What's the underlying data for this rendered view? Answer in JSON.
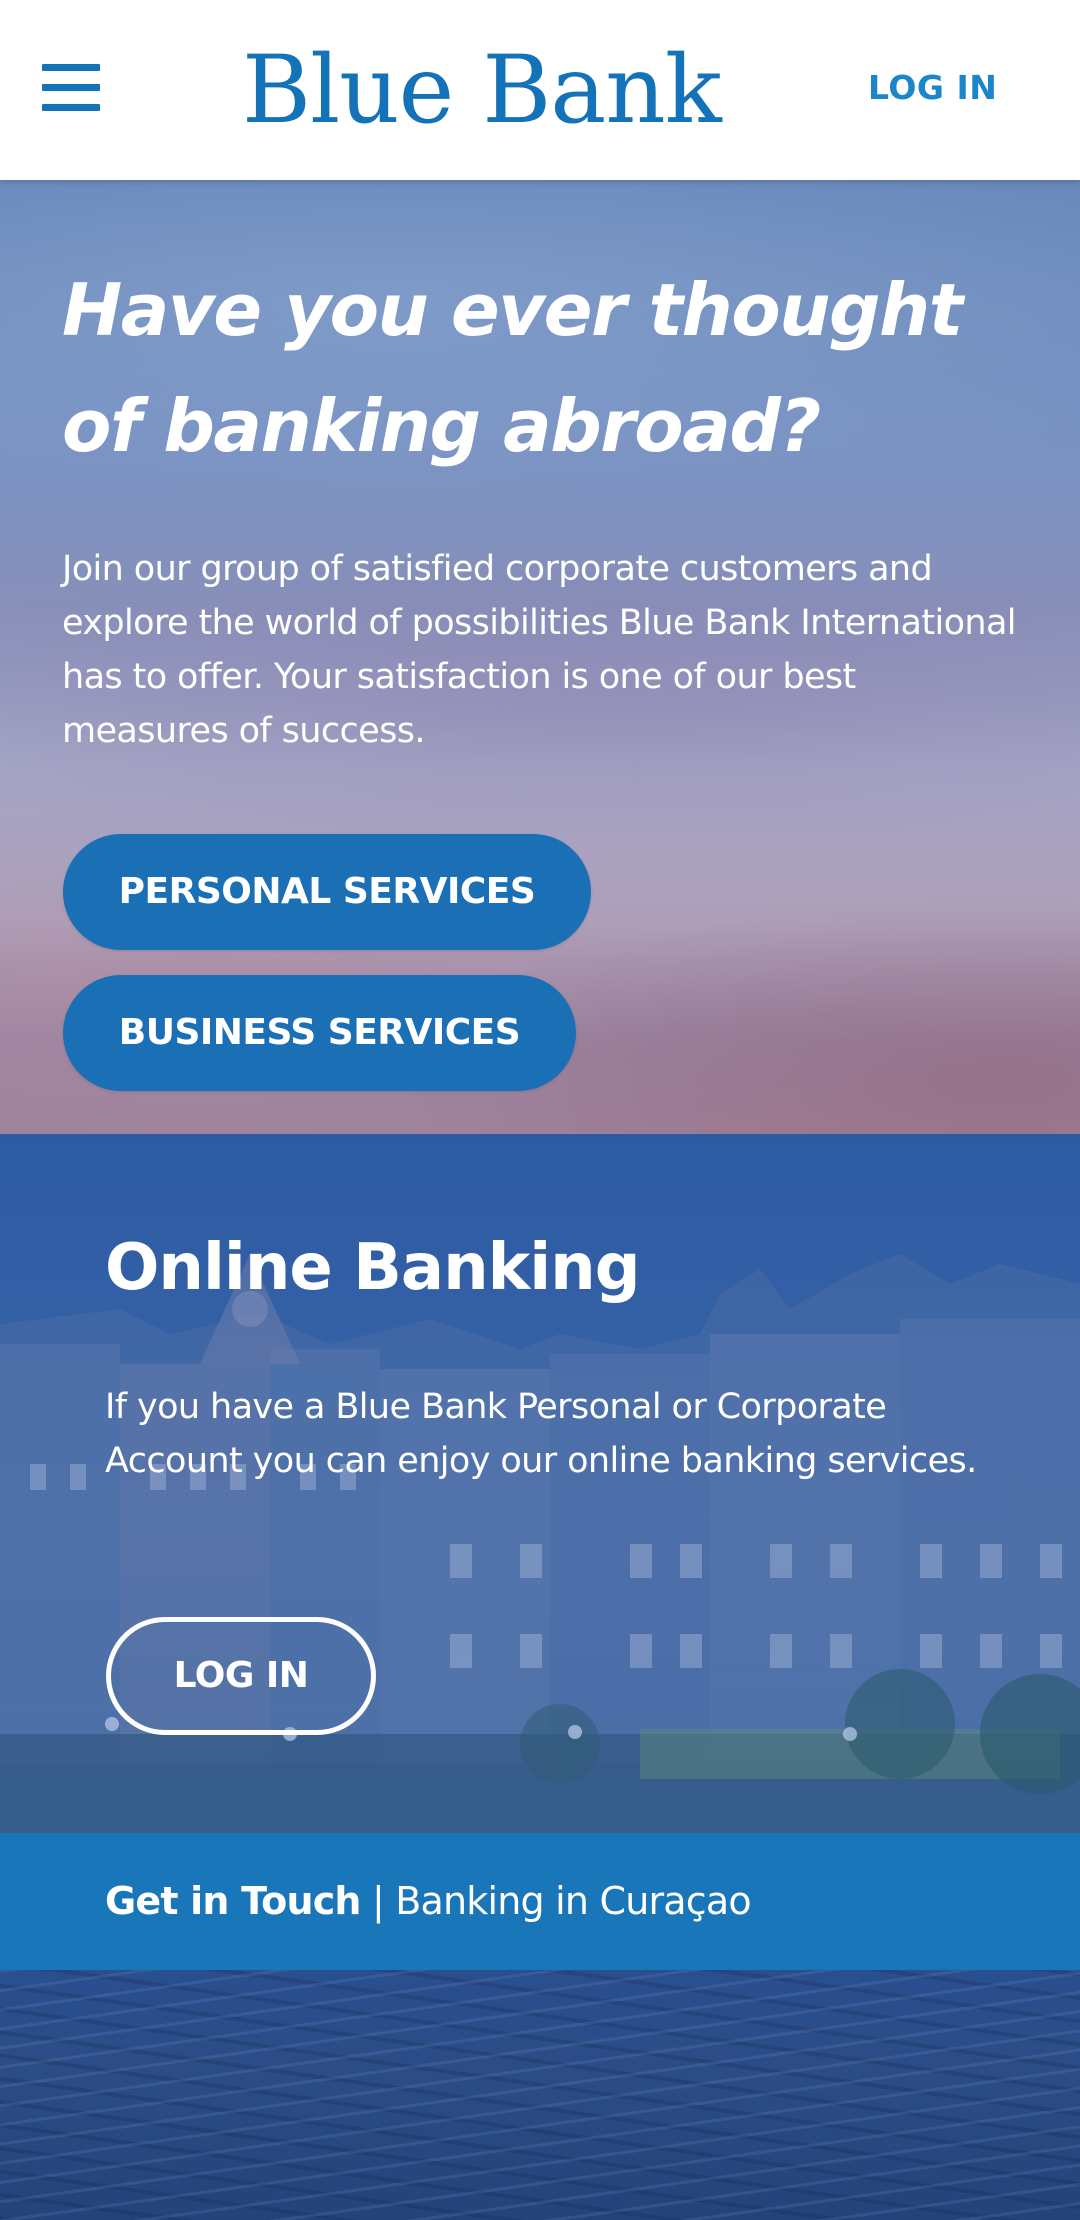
{
  "header": {
    "logo_text": "Blue Bank",
    "login_label": "LOG IN",
    "brand_color": "#1473b8"
  },
  "hero": {
    "title": "Have you ever thought of banking abroad?",
    "text": "Join our group of satisfied corporate customers and explore the world of possibilities Blue Bank International has to offer. Your satisfaction is one of our best measures of success.",
    "personal_services_label": "PERSONAL SERVICES",
    "business_services_label": "BUSINESS SERVICES",
    "button_color": "#1a6fb5"
  },
  "online_banking": {
    "title": "Online Banking",
    "text": "If you have a Blue Bank Personal or Corporate Account you can enjoy our online banking services.",
    "login_label": "LOG IN"
  },
  "contact_bar": {
    "strong_text": "Get in Touch",
    "separator": " | ",
    "location_text": "Banking in Curaçao",
    "bar_color": "#1976b9"
  },
  "icons": {
    "menu": "hamburger-menu-icon"
  }
}
